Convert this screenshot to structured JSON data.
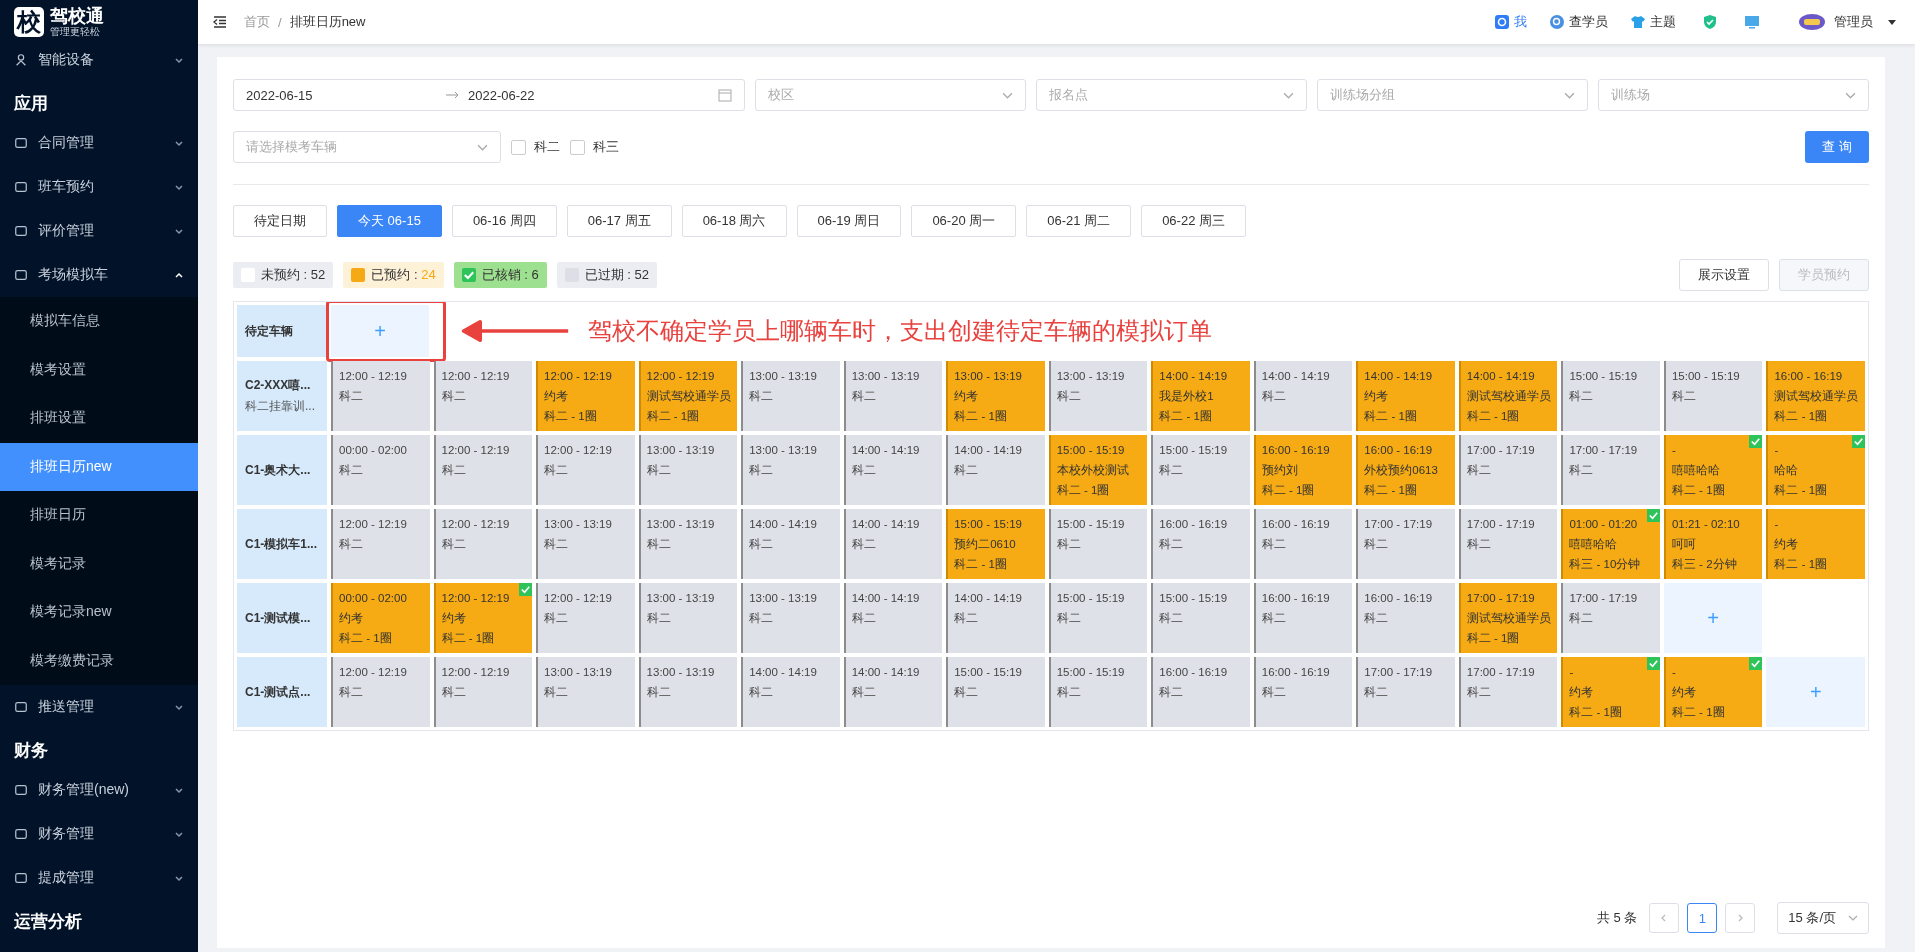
{
  "sidebar": {
    "logo_char": "校",
    "brand": "驾校通",
    "slogan": "管理更轻松",
    "items": [
      {
        "kind": "item",
        "label": "智能设备",
        "expanded": false
      },
      {
        "kind": "section",
        "label": "应用"
      },
      {
        "kind": "item",
        "label": "合同管理",
        "expanded": false
      },
      {
        "kind": "item",
        "label": "班车预约",
        "expanded": false
      },
      {
        "kind": "item",
        "label": "评价管理",
        "expanded": false
      },
      {
        "kind": "item",
        "label": "考场模拟车",
        "expanded": true,
        "children": [
          {
            "label": "模拟车信息",
            "selected": false
          },
          {
            "label": "模考设置",
            "selected": false
          },
          {
            "label": "排班设置",
            "selected": false
          },
          {
            "label": "排班日历new",
            "selected": true
          },
          {
            "label": "排班日历",
            "selected": false
          },
          {
            "label": "模考记录",
            "selected": false
          },
          {
            "label": "模考记录new",
            "selected": false
          },
          {
            "label": "模考缴费记录",
            "selected": false
          }
        ]
      },
      {
        "kind": "item",
        "label": "推送管理",
        "expanded": false
      },
      {
        "kind": "section",
        "label": "财务"
      },
      {
        "kind": "item",
        "label": "财务管理(new)",
        "expanded": false
      },
      {
        "kind": "item",
        "label": "财务管理",
        "expanded": false
      },
      {
        "kind": "item",
        "label": "提成管理",
        "expanded": false
      },
      {
        "kind": "section",
        "label": "运营分析"
      }
    ]
  },
  "header": {
    "breadcrumb": [
      "首页",
      "排班日历new"
    ],
    "breadcrumb_separator": "/",
    "links": [
      {
        "kind": "me",
        "label": "我"
      },
      {
        "kind": "search",
        "label": "查学员"
      },
      {
        "kind": "shirt",
        "label": "主题"
      },
      {
        "kind": "shield"
      },
      {
        "kind": "monitor"
      }
    ],
    "user": "管理员"
  },
  "filters": {
    "date_start": "2022-06-15",
    "date_end": "2022-06-22",
    "selects": [
      "校区",
      "报名点",
      "训练场分组",
      "训练场"
    ],
    "vehicle_placeholder": "请选择模考车辆",
    "checkboxes": [
      {
        "label": "科二",
        "checked": false
      },
      {
        "label": "科三",
        "checked": false
      }
    ],
    "query_button": "查 询"
  },
  "date_tabs": [
    {
      "label": "待定日期",
      "selected": false
    },
    {
      "label": "今天 06-15",
      "selected": true
    },
    {
      "label": "06-16 周四",
      "selected": false
    },
    {
      "label": "06-17 周五",
      "selected": false
    },
    {
      "label": "06-18 周六",
      "selected": false
    },
    {
      "label": "06-19 周日",
      "selected": false
    },
    {
      "label": "06-20 周一",
      "selected": false
    },
    {
      "label": "06-21 周二",
      "selected": false
    },
    {
      "label": "06-22 周三",
      "selected": false
    }
  ],
  "legend": [
    {
      "kind": "free",
      "label": "未预约 : ",
      "count": "52"
    },
    {
      "kind": "booked",
      "label": "已预约 : ",
      "count": "24"
    },
    {
      "kind": "verified",
      "label": "已核销 : ",
      "count": "6"
    },
    {
      "kind": "expired",
      "label": "已过期 : ",
      "count": "52"
    }
  ],
  "actions": [
    {
      "label": "展示设置",
      "disabled": false
    },
    {
      "label": "学员预约",
      "disabled": true
    }
  ],
  "pending_row": {
    "label": "待定车辆",
    "add": "+",
    "annotation": "驾校不确定学员上哪辆车时，支出创建待定车辆的模拟订单"
  },
  "rows": [
    {
      "name": "C2-XXX嘻...",
      "sub": "科二挂靠训...",
      "cells": [
        {
          "kind": "slot",
          "booked": false,
          "verified": false,
          "lines": [
            "12:00 - 12:19",
            "科二"
          ]
        },
        {
          "kind": "slot",
          "booked": false,
          "verified": false,
          "lines": [
            "12:00 - 12:19",
            "科二"
          ]
        },
        {
          "kind": "slot",
          "booked": true,
          "verified": false,
          "lines": [
            "12:00 - 12:19",
            "约考",
            "科二 - 1圈"
          ]
        },
        {
          "kind": "slot",
          "booked": true,
          "verified": false,
          "lines": [
            "12:00 - 12:19",
            "测试驾校通学员",
            "科二 - 1圈"
          ]
        },
        {
          "kind": "slot",
          "booked": false,
          "verified": false,
          "lines": [
            "13:00 - 13:19",
            "科二"
          ]
        },
        {
          "kind": "slot",
          "booked": false,
          "verified": false,
          "lines": [
            "13:00 - 13:19",
            "科二"
          ]
        },
        {
          "kind": "slot",
          "booked": true,
          "verified": false,
          "lines": [
            "13:00 - 13:19",
            "约考",
            "科二 - 1圈"
          ]
        },
        {
          "kind": "slot",
          "booked": false,
          "verified": false,
          "lines": [
            "13:00 - 13:19",
            "科二"
          ]
        },
        {
          "kind": "slot",
          "booked": true,
          "verified": false,
          "lines": [
            "14:00 - 14:19",
            "我是外校1",
            "科二 - 1圈"
          ]
        },
        {
          "kind": "slot",
          "booked": false,
          "verified": false,
          "lines": [
            "14:00 - 14:19",
            "科二"
          ]
        },
        {
          "kind": "slot",
          "booked": true,
          "verified": false,
          "lines": [
            "14:00 - 14:19",
            "约考",
            "科二 - 1圈"
          ]
        },
        {
          "kind": "slot",
          "booked": true,
          "verified": false,
          "lines": [
            "14:00 - 14:19",
            "测试驾校通学员",
            "科二 - 1圈"
          ]
        },
        {
          "kind": "slot",
          "booked": false,
          "verified": false,
          "lines": [
            "15:00 - 15:19",
            "科二"
          ]
        },
        {
          "kind": "slot",
          "booked": false,
          "verified": false,
          "lines": [
            "15:00 - 15:19",
            "科二"
          ]
        },
        {
          "kind": "slot",
          "booked": true,
          "verified": false,
          "lines": [
            "16:00 - 16:19",
            "测试驾校通学员",
            "科二 - 1圈"
          ]
        }
      ]
    },
    {
      "name": "C1-奥术大...",
      "cells": [
        {
          "kind": "slot",
          "booked": false,
          "verified": false,
          "lines": [
            "00:00 - 02:00",
            "科二"
          ]
        },
        {
          "kind": "slot",
          "booked": false,
          "verified": false,
          "lines": [
            "12:00 - 12:19",
            "科二"
          ]
        },
        {
          "kind": "slot",
          "booked": false,
          "verified": false,
          "lines": [
            "12:00 - 12:19",
            "科二"
          ]
        },
        {
          "kind": "slot",
          "booked": false,
          "verified": false,
          "lines": [
            "13:00 - 13:19",
            "科二"
          ]
        },
        {
          "kind": "slot",
          "booked": false,
          "verified": false,
          "lines": [
            "13:00 - 13:19",
            "科二"
          ]
        },
        {
          "kind": "slot",
          "booked": false,
          "verified": false,
          "lines": [
            "14:00 - 14:19",
            "科二"
          ]
        },
        {
          "kind": "slot",
          "booked": false,
          "verified": false,
          "lines": [
            "14:00 - 14:19",
            "科二"
          ]
        },
        {
          "kind": "slot",
          "booked": true,
          "verified": false,
          "lines": [
            "15:00 - 15:19",
            "本校外校测试",
            "科二 - 1圈"
          ]
        },
        {
          "kind": "slot",
          "booked": false,
          "verified": false,
          "lines": [
            "15:00 - 15:19",
            "科二"
          ]
        },
        {
          "kind": "slot",
          "booked": true,
          "verified": false,
          "lines": [
            "16:00 - 16:19",
            "预约刘",
            "科二 - 1圈"
          ]
        },
        {
          "kind": "slot",
          "booked": true,
          "verified": false,
          "lines": [
            "16:00 - 16:19",
            "外校预约0613",
            "科二 - 1圈"
          ]
        },
        {
          "kind": "slot",
          "booked": false,
          "verified": false,
          "lines": [
            "17:00 - 17:19",
            "科二"
          ]
        },
        {
          "kind": "slot",
          "booked": false,
          "verified": false,
          "lines": [
            "17:00 - 17:19",
            "科二"
          ]
        },
        {
          "kind": "slot",
          "booked": true,
          "verified": true,
          "lines": [
            "-",
            "嘻嘻哈哈",
            "科二 - 1圈"
          ]
        },
        {
          "kind": "slot",
          "booked": true,
          "verified": true,
          "lines": [
            "-",
            "哈哈",
            "科二 - 1圈"
          ]
        }
      ]
    },
    {
      "name": "C1-模拟车1...",
      "cells": [
        {
          "kind": "slot",
          "booked": false,
          "verified": false,
          "lines": [
            "12:00 - 12:19",
            "科二"
          ]
        },
        {
          "kind": "slot",
          "booked": false,
          "verified": false,
          "lines": [
            "12:00 - 12:19",
            "科二"
          ]
        },
        {
          "kind": "slot",
          "booked": false,
          "verified": false,
          "lines": [
            "13:00 - 13:19",
            "科二"
          ]
        },
        {
          "kind": "slot",
          "booked": false,
          "verified": false,
          "lines": [
            "13:00 - 13:19",
            "科二"
          ]
        },
        {
          "kind": "slot",
          "booked": false,
          "verified": false,
          "lines": [
            "14:00 - 14:19",
            "科二"
          ]
        },
        {
          "kind": "slot",
          "booked": false,
          "verified": false,
          "lines": [
            "14:00 - 14:19",
            "科二"
          ]
        },
        {
          "kind": "slot",
          "booked": true,
          "verified": false,
          "lines": [
            "15:00 - 15:19",
            "预约二0610",
            "科二 - 1圈"
          ]
        },
        {
          "kind": "slot",
          "booked": false,
          "verified": false,
          "lines": [
            "15:00 - 15:19",
            "科二"
          ]
        },
        {
          "kind": "slot",
          "booked": false,
          "verified": false,
          "lines": [
            "16:00 - 16:19",
            "科二"
          ]
        },
        {
          "kind": "slot",
          "booked": false,
          "verified": false,
          "lines": [
            "16:00 - 16:19",
            "科二"
          ]
        },
        {
          "kind": "slot",
          "booked": false,
          "verified": false,
          "lines": [
            "17:00 - 17:19",
            "科二"
          ]
        },
        {
          "kind": "slot",
          "booked": false,
          "verified": false,
          "lines": [
            "17:00 - 17:19",
            "科二"
          ]
        },
        {
          "kind": "slot",
          "booked": true,
          "verified": true,
          "lines": [
            "01:00 - 01:20",
            "嘻嘻哈哈",
            "科三 - 10分钟"
          ]
        },
        {
          "kind": "slot",
          "booked": true,
          "verified": false,
          "lines": [
            "01:21 - 02:10",
            "呵呵",
            "科三 - 2分钟"
          ]
        },
        {
          "kind": "slot",
          "booked": true,
          "verified": false,
          "lines": [
            "-",
            "约考",
            "科二 - 1圈"
          ]
        }
      ]
    },
    {
      "name": "C1-测试模...",
      "cells": [
        {
          "kind": "slot",
          "booked": true,
          "verified": false,
          "lines": [
            "00:00 - 02:00",
            "约考",
            "科二 - 1圈"
          ]
        },
        {
          "kind": "slot",
          "booked": true,
          "verified": true,
          "lines": [
            "12:00 - 12:19",
            "约考",
            "科二 - 1圈"
          ]
        },
        {
          "kind": "slot",
          "booked": false,
          "verified": false,
          "lines": [
            "12:00 - 12:19",
            "科二"
          ]
        },
        {
          "kind": "slot",
          "booked": false,
          "verified": false,
          "lines": [
            "13:00 - 13:19",
            "科二"
          ]
        },
        {
          "kind": "slot",
          "booked": false,
          "verified": false,
          "lines": [
            "13:00 - 13:19",
            "科二"
          ]
        },
        {
          "kind": "slot",
          "booked": false,
          "verified": false,
          "lines": [
            "14:00 - 14:19",
            "科二"
          ]
        },
        {
          "kind": "slot",
          "booked": false,
          "verified": false,
          "lines": [
            "14:00 - 14:19",
            "科二"
          ]
        },
        {
          "kind": "slot",
          "booked": false,
          "verified": false,
          "lines": [
            "15:00 - 15:19",
            "科二"
          ]
        },
        {
          "kind": "slot",
          "booked": false,
          "verified": false,
          "lines": [
            "15:00 - 15:19",
            "科二"
          ]
        },
        {
          "kind": "slot",
          "booked": false,
          "verified": false,
          "lines": [
            "16:00 - 16:19",
            "科二"
          ]
        },
        {
          "kind": "slot",
          "booked": false,
          "verified": false,
          "lines": [
            "16:00 - 16:19",
            "科二"
          ]
        },
        {
          "kind": "slot",
          "booked": true,
          "verified": false,
          "lines": [
            "17:00 - 17:19",
            "测试驾校通学员",
            "科二 - 1圈"
          ]
        },
        {
          "kind": "slot",
          "booked": false,
          "verified": false,
          "lines": [
            "17:00 - 17:19",
            "科二"
          ]
        },
        {
          "kind": "add",
          "label": "+"
        }
      ]
    },
    {
      "name": "C1-测试点...",
      "cells": [
        {
          "kind": "slot",
          "booked": false,
          "verified": false,
          "lines": [
            "12:00 - 12:19",
            "科二"
          ]
        },
        {
          "kind": "slot",
          "booked": false,
          "verified": false,
          "lines": [
            "12:00 - 12:19",
            "科二"
          ]
        },
        {
          "kind": "slot",
          "booked": false,
          "verified": false,
          "lines": [
            "13:00 - 13:19",
            "科二"
          ]
        },
        {
          "kind": "slot",
          "booked": false,
          "verified": false,
          "lines": [
            "13:00 - 13:19",
            "科二"
          ]
        },
        {
          "kind": "slot",
          "booked": false,
          "verified": false,
          "lines": [
            "14:00 - 14:19",
            "科二"
          ]
        },
        {
          "kind": "slot",
          "booked": false,
          "verified": false,
          "lines": [
            "14:00 - 14:19",
            "科二"
          ]
        },
        {
          "kind": "slot",
          "booked": false,
          "verified": false,
          "lines": [
            "15:00 - 15:19",
            "科二"
          ]
        },
        {
          "kind": "slot",
          "booked": false,
          "verified": false,
          "lines": [
            "15:00 - 15:19",
            "科二"
          ]
        },
        {
          "kind": "slot",
          "booked": false,
          "verified": false,
          "lines": [
            "16:00 - 16:19",
            "科二"
          ]
        },
        {
          "kind": "slot",
          "booked": false,
          "verified": false,
          "lines": [
            "16:00 - 16:19",
            "科二"
          ]
        },
        {
          "kind": "slot",
          "booked": false,
          "verified": false,
          "lines": [
            "17:00 - 17:19",
            "科二"
          ]
        },
        {
          "kind": "slot",
          "booked": false,
          "verified": false,
          "lines": [
            "17:00 - 17:19",
            "科二"
          ]
        },
        {
          "kind": "slot",
          "booked": true,
          "verified": true,
          "lines": [
            "-",
            "约考",
            "科二 - 1圈"
          ]
        },
        {
          "kind": "slot",
          "booked": true,
          "verified": true,
          "lines": [
            "-",
            "约考",
            "科二 - 1圈"
          ]
        },
        {
          "kind": "add",
          "label": "+"
        }
      ]
    }
  ],
  "pagination": {
    "total": "共 5 条",
    "pages": [
      {
        "label": "1",
        "selected": true
      }
    ],
    "page_size": "15 条/页"
  }
}
